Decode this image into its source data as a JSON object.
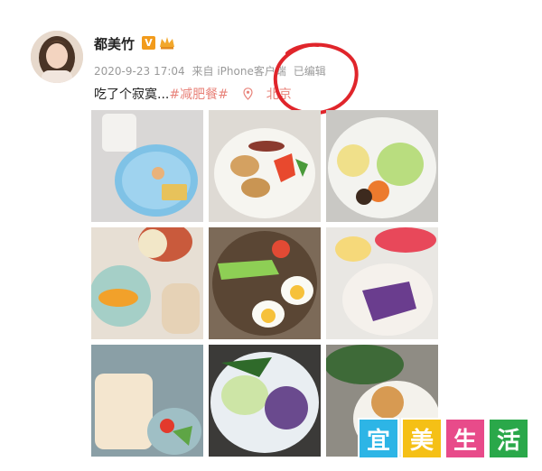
{
  "user": {
    "name": "都美竹",
    "verified_badge": "V"
  },
  "post": {
    "date": "2020-9-23",
    "time": "17:04",
    "source": "来自 iPhone客户端",
    "edited": "已编辑",
    "text": "吃了个寂寞...",
    "hashtag": "#减肥餐#",
    "location": "北京"
  },
  "watermark": {
    "chars": [
      "宜",
      "美",
      "生",
      "活"
    ],
    "colors": [
      "#2db5e6",
      "#f5c016",
      "#e84b8a",
      "#2aa84a"
    ]
  },
  "colors": {
    "annotation": "#e0252b",
    "link": "#e8837a",
    "meta": "#9a9a9a"
  },
  "icons": [
    "crown-icon",
    "location-pin-icon"
  ]
}
